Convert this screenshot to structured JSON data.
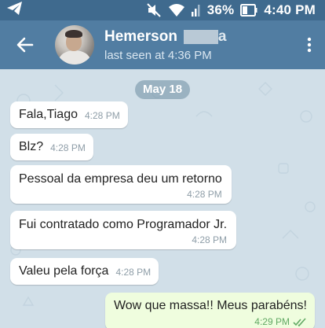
{
  "status_bar": {
    "battery": "36%",
    "time": "4:40 PM",
    "icons": [
      "telegram-icon",
      "mute-icon",
      "wifi-icon",
      "signal-icon",
      "battery-icon"
    ]
  },
  "header": {
    "contact_name": "Hemerson",
    "contact_name_tail": "a",
    "last_seen": "last seen at 4:36 PM",
    "icons": [
      "back-arrow-icon",
      "more-vert-icon"
    ]
  },
  "chat": {
    "date": "May 18",
    "messages": [
      {
        "text": "Fala,Tiago",
        "time": "4:28 PM",
        "direction": "in"
      },
      {
        "text": "Blz?",
        "time": "4:28 PM",
        "direction": "in"
      },
      {
        "text": "Pessoal da empresa deu um retorno",
        "time": "4:28 PM",
        "direction": "in"
      },
      {
        "text": "Fui contratado como Programador Jr.",
        "time": "4:28 PM",
        "direction": "in"
      },
      {
        "text": "Valeu pela força",
        "time": "4:28 PM",
        "direction": "in"
      },
      {
        "text": "Wow que massa!! Meus parabéns!",
        "time": "4:29 PM",
        "direction": "out",
        "read": true
      }
    ]
  },
  "colors": {
    "status_bar": "#3f6a8e",
    "header": "#517da2",
    "chat_background": "#d1dfe8",
    "incoming_bubble": "#ffffff",
    "outgoing_bubble": "#effdde",
    "outgoing_time": "#62a964"
  }
}
